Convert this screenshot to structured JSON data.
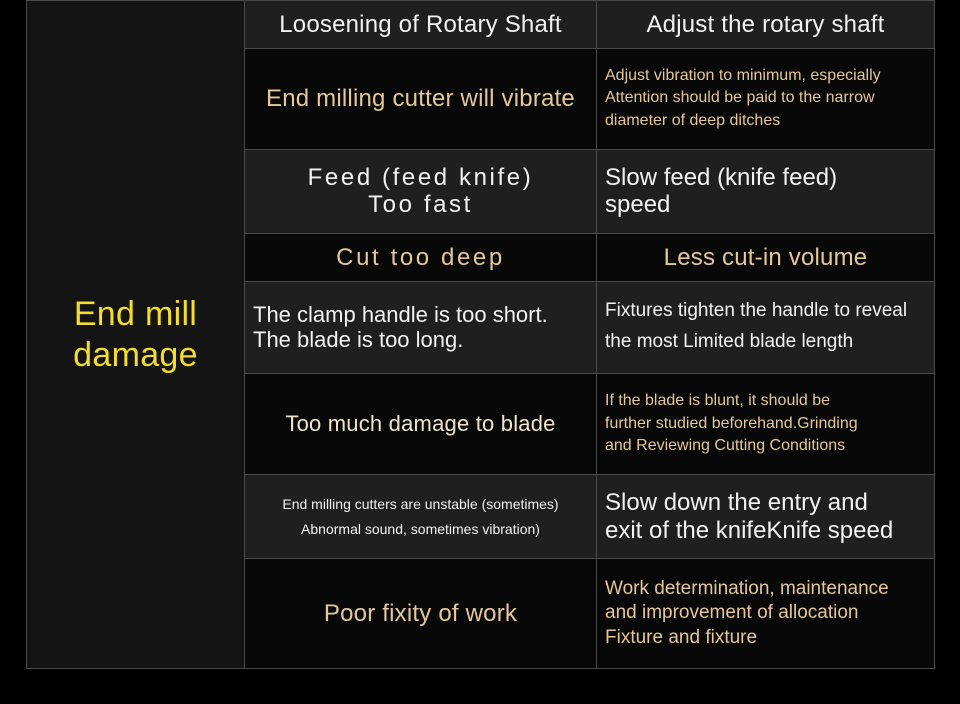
{
  "table": {
    "category": {
      "label": "End mill\ndamage",
      "color": "#f5dd2e"
    },
    "rows": [
      {
        "symptom": "Loosening of Rotary Shaft",
        "remedy": "Adjust the rotary shaft",
        "band": "grey"
      },
      {
        "symptom": "End milling cutter will vibrate",
        "remedy": "Adjust vibration to minimum, especially\nAttention should be paid to the narrow\ndiameter of deep ditches",
        "band": "black"
      },
      {
        "symptom": "Feed (feed knife)\nToo fast",
        "remedy": "Slow feed (knife feed)\nspeed",
        "band": "grey"
      },
      {
        "symptom": "Cut too deep",
        "remedy": "Less cut-in volume",
        "band": "black"
      },
      {
        "symptom": "The clamp handle is too short.\nThe blade is too long.",
        "remedy": "Fixtures tighten the handle to reveal\nthe most Limited blade length",
        "band": "grey"
      },
      {
        "symptom": "Too much damage to blade",
        "remedy": "If the blade is blunt, it should be\nfurther studied beforehand.Grinding\nand Reviewing Cutting Conditions",
        "band": "black"
      },
      {
        "symptom": "End milling cutters are unstable (sometimes)\nAbnormal sound, sometimes vibration)",
        "remedy": "Slow down the entry and\nexit of the knifeKnife speed",
        "band": "grey"
      },
      {
        "symptom": "Poor fixity of work",
        "remedy": "Work determination, maintenance\nand improvement of allocation\nFixture and fixture",
        "band": "black"
      }
    ]
  },
  "colors": {
    "background": "#000000",
    "band_grey": "#1f1f20",
    "band_black": "#080808",
    "border": "#4a4a4a",
    "accent_yellow": "#f5dd2e",
    "text_white": "#f2f2f2",
    "text_beige": "#e4c79a"
  }
}
